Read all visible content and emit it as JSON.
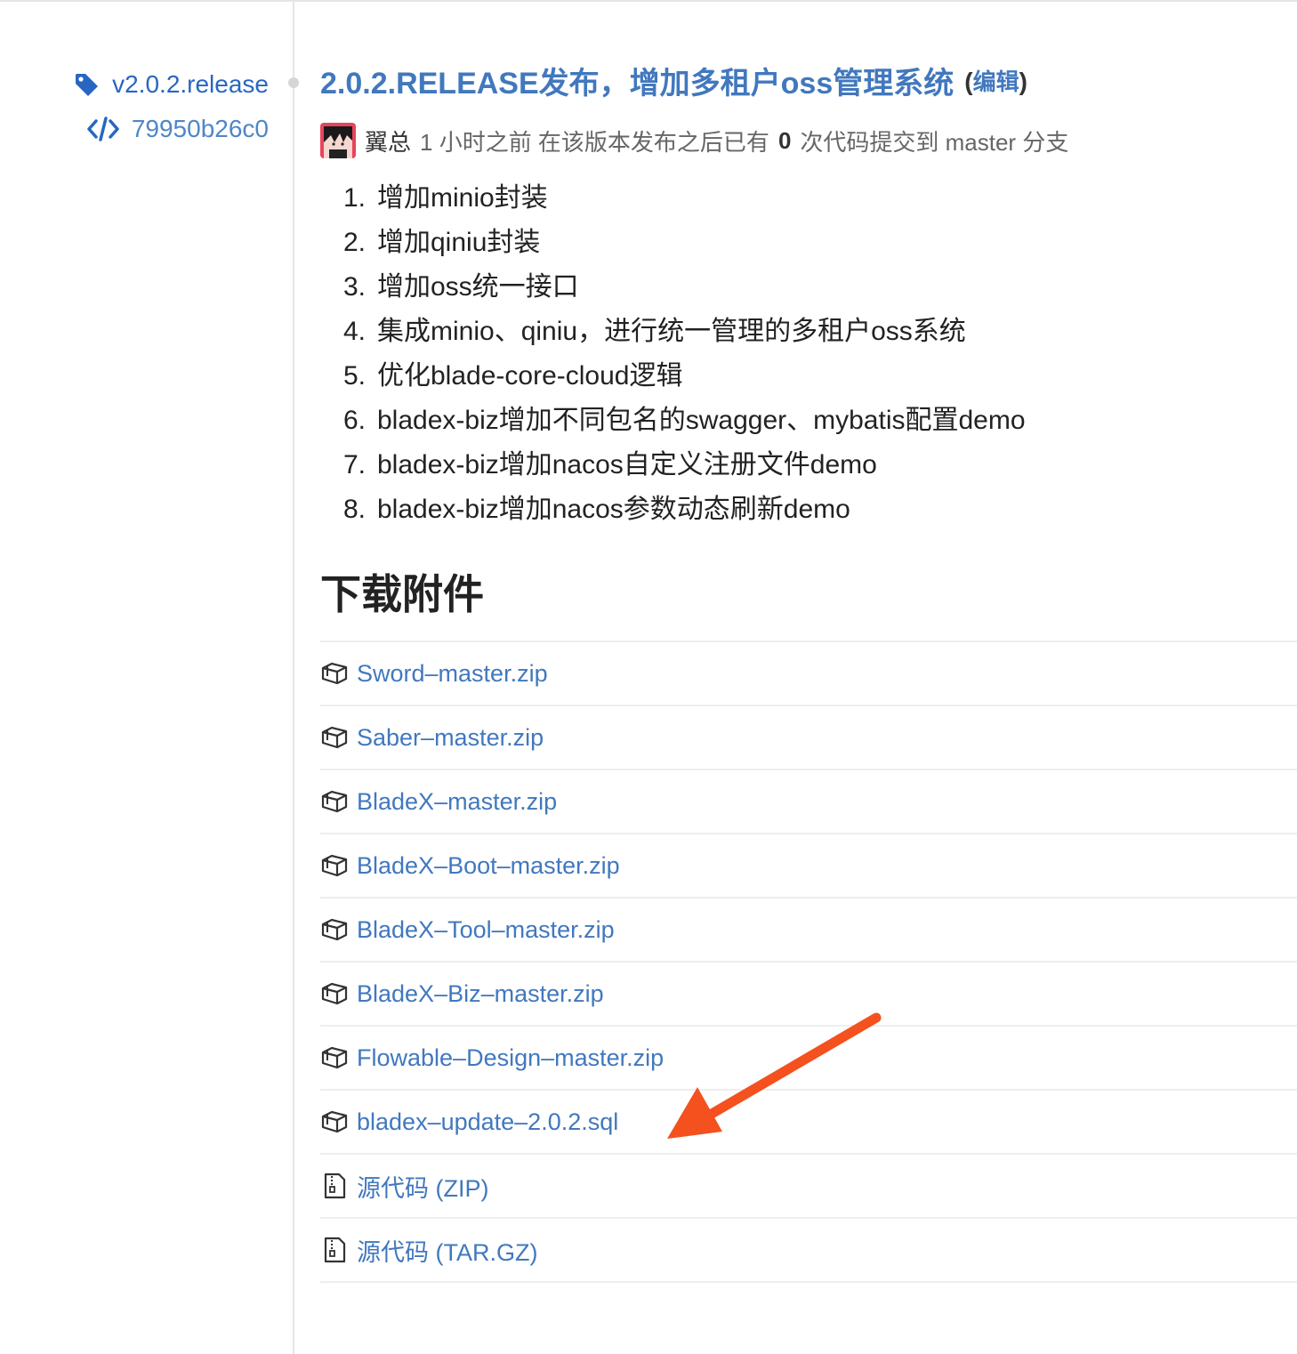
{
  "release": {
    "tag": "v2.0.2.release",
    "commit": "79950b26c0",
    "title": "2.0.2.RELEASE发布，增加多租户oss管理系统",
    "edit_open": "(",
    "edit_label": "编辑",
    "edit_close": ")",
    "author": "翼总",
    "time_ago": "1 小时之前 在该版本发布之后已有",
    "commit_count": "0",
    "branch_text": "次代码提交到 master 分支"
  },
  "notes": [
    {
      "num": "1.",
      "text": "增加minio封装"
    },
    {
      "num": "2.",
      "text": "增加qiniu封装"
    },
    {
      "num": "3.",
      "text": "增加oss统一接口"
    },
    {
      "num": "4.",
      "text": "集成minio、qiniu，进行统一管理的多租户oss系统"
    },
    {
      "num": "5.",
      "text": "优化blade-core-cloud逻辑"
    },
    {
      "num": "6.",
      "text": "bladex-biz增加不同包名的swagger、mybatis配置demo"
    },
    {
      "num": "7.",
      "text": "bladex-biz增加nacos自定义注册文件demo"
    },
    {
      "num": "8.",
      "text": "bladex-biz增加nacos参数动态刷新demo"
    }
  ],
  "downloads": {
    "heading": "下载附件",
    "assets": [
      {
        "name": "Sword–master.zip",
        "icon": "package-icon"
      },
      {
        "name": "Saber–master.zip",
        "icon": "package-icon"
      },
      {
        "name": "BladeX–master.zip",
        "icon": "package-icon"
      },
      {
        "name": "BladeX–Boot–master.zip",
        "icon": "package-icon"
      },
      {
        "name": "BladeX–Tool–master.zip",
        "icon": "package-icon"
      },
      {
        "name": "BladeX–Biz–master.zip",
        "icon": "package-icon"
      },
      {
        "name": "Flowable–Design–master.zip",
        "icon": "package-icon"
      },
      {
        "name": "bladex–update–2.0.2.sql",
        "icon": "package-icon"
      },
      {
        "name": "源代码 (ZIP)",
        "icon": "file-zip-icon"
      },
      {
        "name": "源代码 (TAR.GZ)",
        "icon": "file-zip-icon"
      }
    ]
  },
  "colors": {
    "link": "#4178be",
    "tag": "#2866c2",
    "arrow": "#f4511e"
  }
}
